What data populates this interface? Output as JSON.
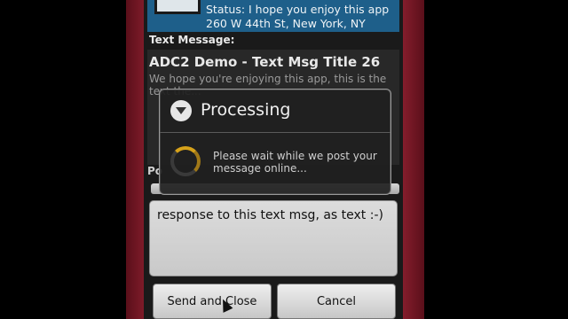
{
  "status": {
    "line1": "Status: I hope you enjoy this app",
    "line2": "260 W 44th St, New York, NY"
  },
  "text_message": {
    "section_label": "Text Message:",
    "title": "ADC2 Demo - Text Msg Title 26",
    "body": "We hope you're enjoying this app, this is the text the..."
  },
  "post_section": {
    "label": "Po"
  },
  "response": {
    "value": "response to this text msg, as text :-)"
  },
  "buttons": {
    "send_close": "Send and Close",
    "cancel": "Cancel"
  },
  "dialog": {
    "title": "Processing",
    "message": "Please wait while we post your message online..."
  },
  "colors": {
    "status_bg": "#1e5f8a",
    "phone_frame": "#8a1f2e",
    "spinner": "#d6a21a"
  }
}
